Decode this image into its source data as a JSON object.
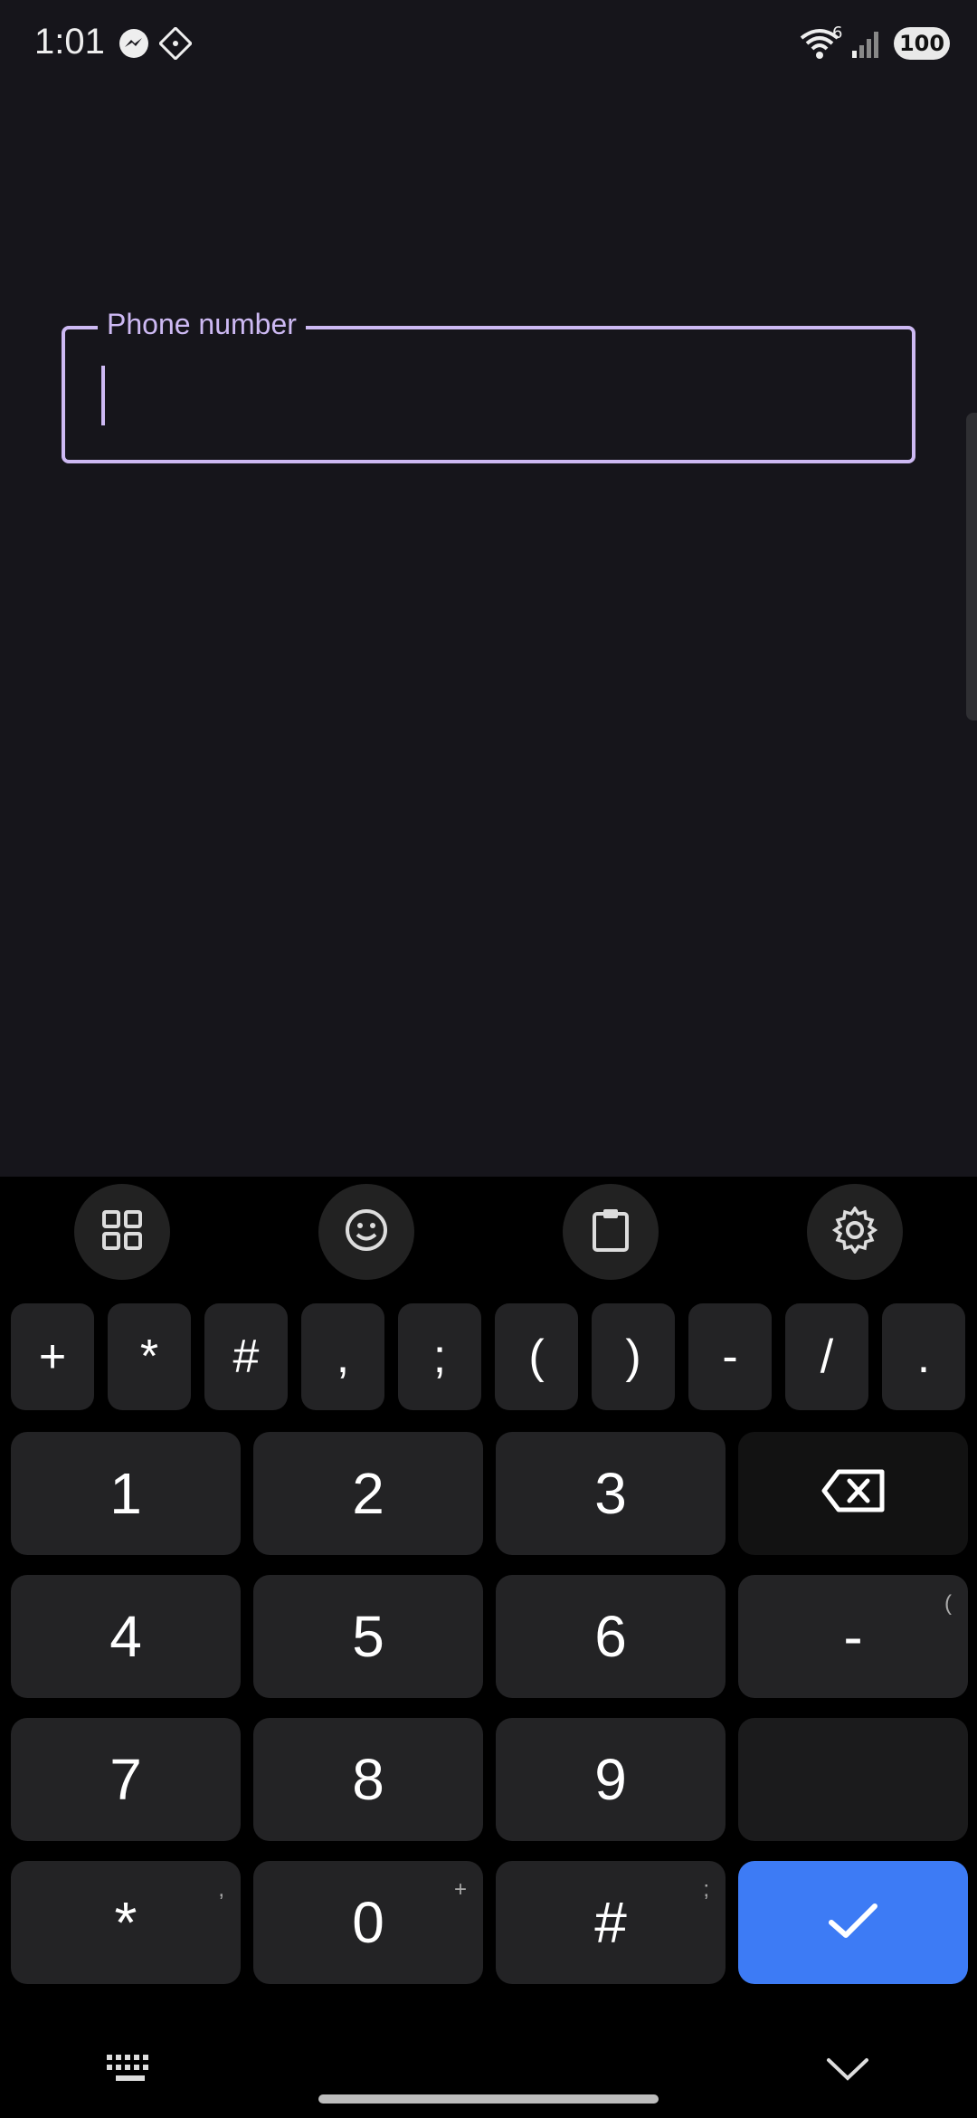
{
  "status_bar": {
    "time": "1:01",
    "battery": "100",
    "wifi_badge": "6"
  },
  "form": {
    "phone_label": "Phone number",
    "phone_value": "",
    "accent_color": "#cdb9f3"
  },
  "keyboard": {
    "symbols": [
      "+",
      "*",
      "#",
      ",",
      ";",
      "(",
      ")",
      "-",
      "/",
      "."
    ],
    "row1": [
      "1",
      "2",
      "3"
    ],
    "row2": [
      "4",
      "5",
      "6"
    ],
    "row3": [
      "7",
      "8",
      "9"
    ],
    "row4": [
      "*",
      "0",
      "#"
    ],
    "hints": {
      "star": ",",
      "zero": "+",
      "hash": ";",
      "dash": "("
    },
    "dash_key": "-",
    "confirm_color": "#3d7bf5"
  }
}
